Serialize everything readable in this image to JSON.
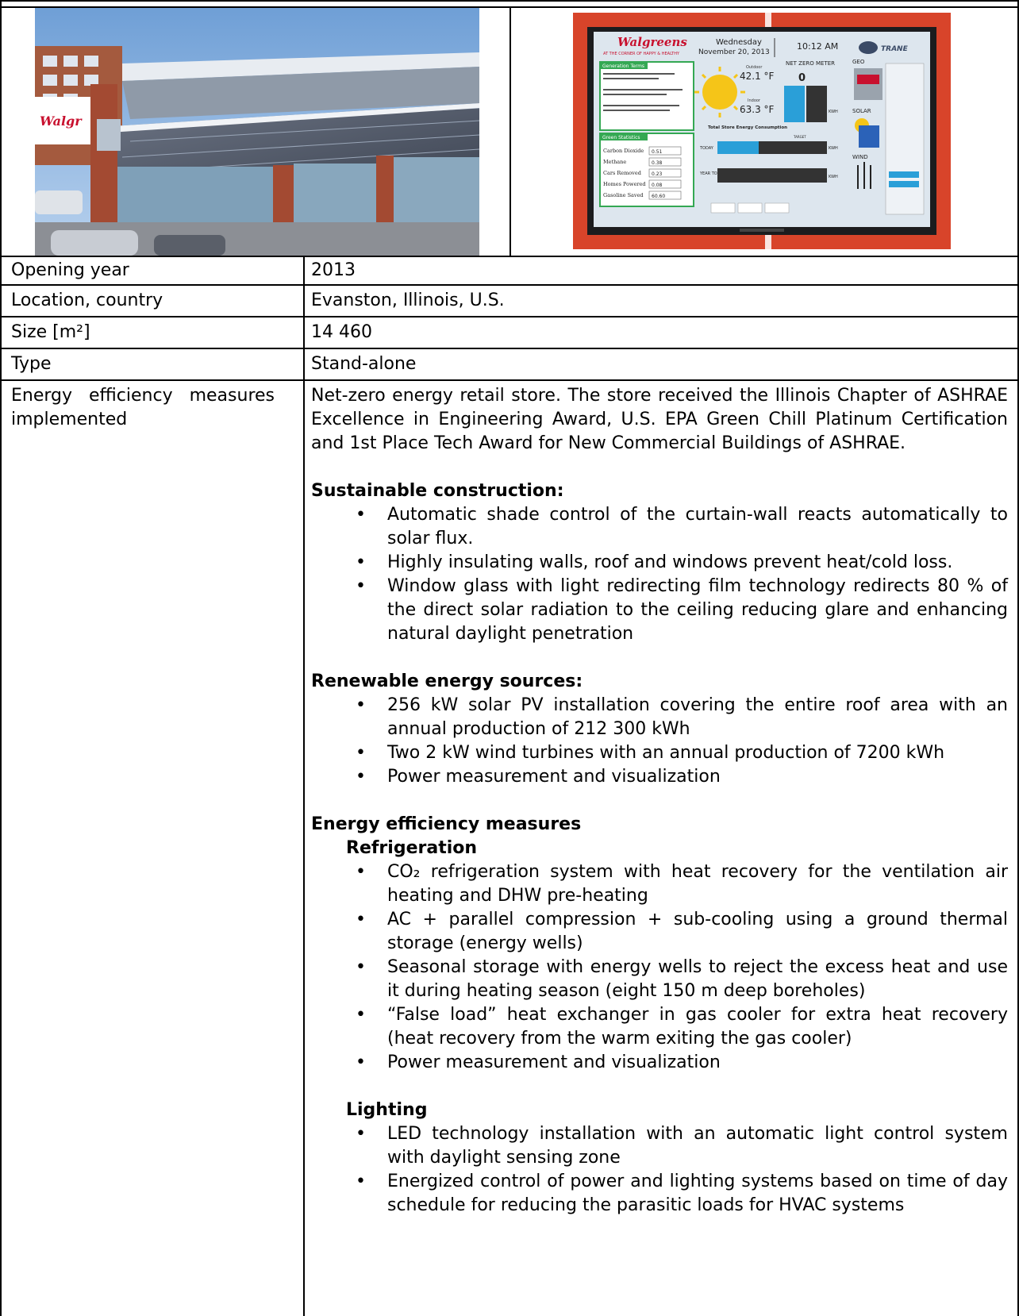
{
  "images": {
    "store_photo": {
      "description_icon": "store-exterior-photo"
    },
    "display_photo": {
      "brand": "Walgreens",
      "tagline": "AT THE CORNER OF HAPPY & HEALTHY",
      "day": "Wednesday",
      "date": "November 20, 2013",
      "time": "10:12 AM",
      "vendor": "TRANE",
      "outdoor_label": "Outdoor",
      "outdoor_temp": "42.1 °F",
      "indoor_label": "Indoor",
      "indoor_temp": "63.3 °F",
      "meter_title": "NET ZERO METER",
      "meter_value": "0",
      "kwh": "KWH",
      "geo": "GEO",
      "solar": "SOLAR",
      "wind": "WIND",
      "generation_terms": "Generation Terms",
      "green_statistics": "Green Statistics",
      "consumption_title": "Total Store Energy Consumption",
      "today": "TODAY",
      "year_to_date": "YEAR TO DATE",
      "target": "TARGET",
      "stats": [
        {
          "label": "Carbon Dioxide",
          "value": "0.51"
        },
        {
          "label": "Methane",
          "value": "0.38"
        },
        {
          "label": "Cars Removed",
          "value": "0.23"
        },
        {
          "label": "Homes Powered",
          "value": "0.08"
        },
        {
          "label": "Gasoline Saved",
          "value": "60.60"
        }
      ]
    }
  },
  "table": {
    "rows": [
      {
        "label": "Opening year",
        "value": "2013"
      },
      {
        "label": "Location, country",
        "value": "Evanston, Illinois, U.S."
      },
      {
        "label": "Size [m²]",
        "value": "14 460"
      },
      {
        "label": "Type",
        "value": "Stand-alone"
      }
    ],
    "measures_label_line1": "Energy   efficiency   measures",
    "measures_label_line2": "implemented",
    "intro": "Net-zero energy retail store. The store received the Illinois Chapter of ASHRAE Excellence in Engineering Award, U.S. EPA Green Chill Platinum Certification and 1st Place Tech Award for New Commercial Buildings of ASHRAE.",
    "sections": {
      "construction": {
        "heading": "Sustainable construction:",
        "items": [
          "Automatic shade control of the curtain-wall reacts automatically to solar flux.",
          "Highly insulating walls, roof and windows prevent heat/cold loss.",
          "Window glass with light redirecting film technology redirects 80 % of the direct solar radiation to the ceiling reducing glare and enhancing natural daylight penetration"
        ]
      },
      "renewable": {
        "heading": "Renewable energy sources:",
        "items": [
          "256 kW solar PV installation covering the entire roof area with an annual production of 212 300 kWh",
          "Two 2 kW wind turbines with an annual production of 7200 kWh",
          "Power measurement and visualization"
        ]
      },
      "efficiency": {
        "heading": "Energy efficiency measures",
        "refrigeration": {
          "heading": "Refrigeration",
          "items": [
            "CO₂ refrigeration system with heat recovery for the ventilation air heating and DHW pre-heating",
            "AC + parallel compression + sub-cooling using a ground thermal storage (energy wells)",
            "Seasonal storage with energy wells to reject the excess heat and use it during heating season (eight 150 m deep boreholes)",
            "“False load” heat exchanger in gas cooler for extra heat recovery (heat recovery from the warm exiting the gas cooler)",
            "Power measurement and visualization"
          ]
        },
        "lighting": {
          "heading": "Lighting",
          "items": [
            "LED technology installation with an automatic light control system with daylight sensing zone",
            "Energized control of power and lighting systems based on time of day schedule for reducing the parasitic loads for HVAC systems"
          ]
        }
      }
    }
  }
}
